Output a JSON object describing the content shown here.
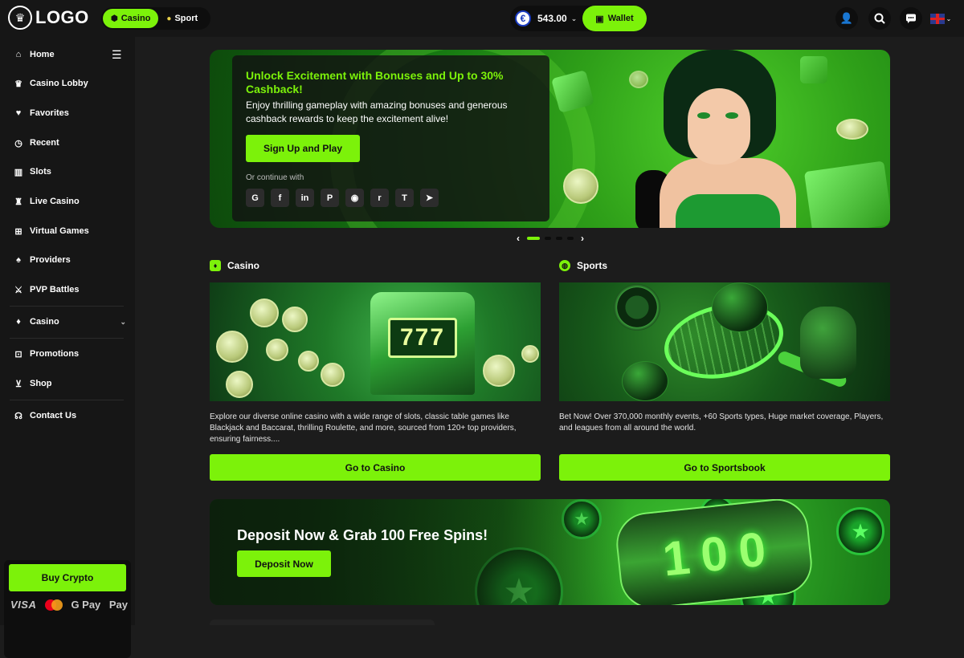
{
  "header": {
    "logo_text": "LOGO",
    "toggle": [
      {
        "label": "Casino",
        "active": true
      },
      {
        "label": "Sport",
        "active": false
      }
    ],
    "balance": {
      "currency_symbol": "€",
      "amount": "543.00"
    },
    "wallet_label": "Wallet",
    "icons": [
      "user-icon",
      "search-icon",
      "chat-icon",
      "uk-flag-icon"
    ]
  },
  "sidebar": {
    "items": [
      {
        "label": "Home",
        "icon": "house"
      },
      {
        "label": "Casino Lobby",
        "icon": "crown"
      },
      {
        "label": "Favorites",
        "icon": "heart"
      },
      {
        "label": "Recent",
        "icon": "clock"
      },
      {
        "label": "Slots",
        "icon": "slots"
      },
      {
        "label": "Live Casino",
        "icon": "dealer"
      },
      {
        "label": "Virtual Games",
        "icon": "gamepad"
      },
      {
        "label": "Providers",
        "icon": "providers"
      },
      {
        "label": "PVP Battles",
        "icon": "swords"
      }
    ],
    "casino_group": {
      "label": "Casino",
      "icon": "cards"
    },
    "items2": [
      {
        "label": "Promotions",
        "icon": "gift"
      },
      {
        "label": "Shop",
        "icon": "cart"
      }
    ],
    "contact": {
      "label": "Contact Us",
      "icon": "headset"
    },
    "buy_crypto_label": "Buy Crypto",
    "payments": [
      "VISA",
      "G Pay",
      " Pay"
    ]
  },
  "hero": {
    "title": "Unlock Excitement with Bonuses and Up to 30% Cashback!",
    "subtitle": "Enjoy thrilling gameplay with  amazing bonuses and generous cashback rewards to keep the excitement alive!",
    "cta_label": "Sign Up and Play",
    "continue_label": "Or continue with",
    "socials": [
      "G",
      "f",
      "in",
      "P",
      "◉",
      "r",
      "T",
      "➤"
    ]
  },
  "carousel": {
    "slides": 4,
    "active": 0
  },
  "sections": {
    "casino": {
      "heading": "Casino",
      "reels": "777",
      "description": "Explore our diverse online casino with a wide range of slots, classic table games like Blackjack and Baccarat, thrilling Roulette, and more, sourced from 120+ top providers, ensuring fairness....",
      "button_label": "Go to Casino"
    },
    "sports": {
      "heading": "Sports",
      "description": "Bet Now! Over 370,000 monthly events, +60 Sports types, Huge market coverage, Players, and leagues from all around the world.",
      "button_label": "Go to Sportsbook"
    }
  },
  "deposit_banner": {
    "title": "Deposit Now & Grab 100 Free Spins!",
    "button_label": "Deposit Now",
    "reel_digits": [
      "1",
      "0",
      "0"
    ]
  },
  "colors": {
    "accent": "#7cf20a",
    "background": "#1c1c1c",
    "sidebar": "#161616"
  }
}
